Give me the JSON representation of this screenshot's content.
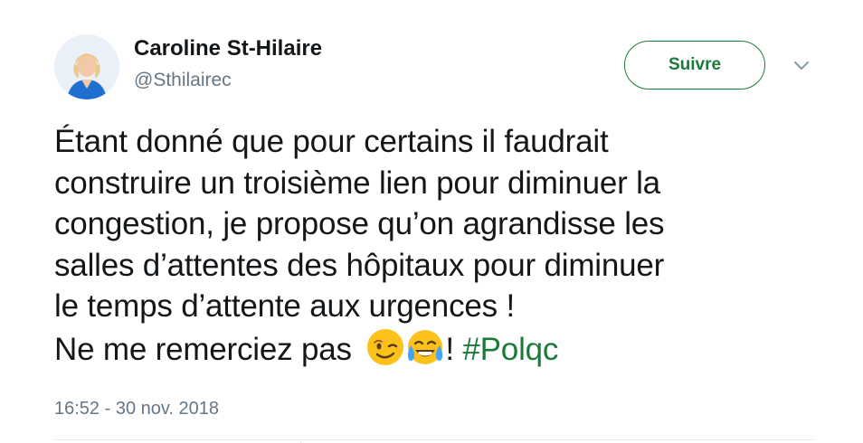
{
  "author": {
    "name": "Caroline St-Hilaire",
    "handle": "@Sthilairec"
  },
  "follow_button": {
    "label": "Suivre"
  },
  "tweet": {
    "lines": [
      "Étant donné que pour certains il faudrait",
      "construire un troisième lien pour diminuer la",
      "congestion, je propose qu’on agrandisse les",
      "salles d’attentes des hôpitaux pour diminuer",
      "le temps d’attente aux urgences !"
    ],
    "last_line_text": "Ne me remerciez pas ",
    "last_line_suffix": "! ",
    "hashtag": "#Polqc",
    "emojis": [
      "winking-face-icon",
      "face-with-tears-of-joy-icon"
    ]
  },
  "timestamp": "16:52 - 30 nov. 2018",
  "colors": {
    "accent": "#1a7a3a",
    "text": "#14171a",
    "muted": "#657786"
  }
}
